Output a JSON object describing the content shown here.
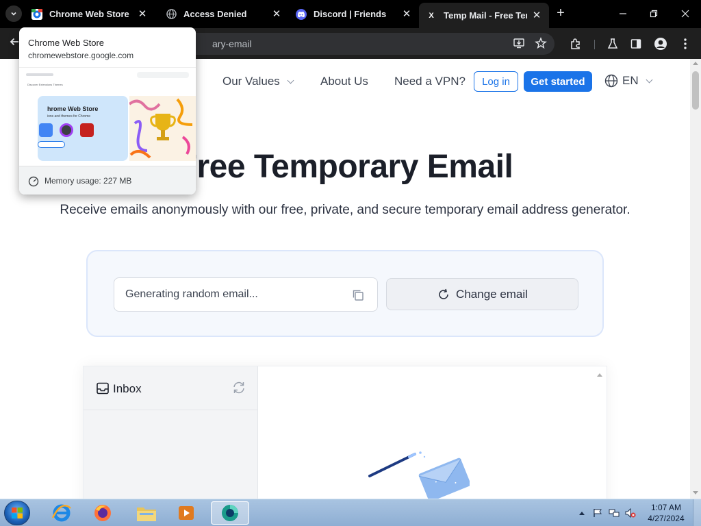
{
  "browser": {
    "tabs": [
      {
        "title": "Chrome Web Store",
        "favicon": "chrome-web-store-icon",
        "active": false
      },
      {
        "title": "Access Denied",
        "favicon": "globe-icon",
        "active": false
      },
      {
        "title": "Discord | Friends",
        "favicon": "discord-icon",
        "active": false
      },
      {
        "title": "Temp Mail - Free Temp",
        "favicon": "x-logo-icon",
        "active": true
      }
    ],
    "new_tab": "+",
    "address": "ary-email"
  },
  "hover_card": {
    "title": "Chrome Web Store",
    "domain": "chromewebstore.google.com",
    "memory": "Memory usage: 227 MB",
    "preview": {
      "banner_title": "hrome Web Store",
      "banner_sub": "ions and themes for Chrome",
      "tabs_text": "Discover   Extensions   Themes"
    }
  },
  "site": {
    "nav": {
      "values": "Our Values",
      "about": "About Us",
      "vpn": "Need a VPN?",
      "login": "Log in",
      "get_started": "Get started",
      "lang": "EN"
    },
    "hero": {
      "title": "Free Temporary Email",
      "subtitle": "Receive emails anonymously with our free, private, and secure temporary email address generator."
    },
    "generator": {
      "email_value": "Generating random email...",
      "change_label": "Change email"
    },
    "inbox": {
      "label": "Inbox"
    }
  },
  "taskbar": {
    "apps": [
      "internet-explorer",
      "firefox",
      "file-explorer",
      "media-player",
      "chrome-web-store"
    ],
    "time": "1:07 AM",
    "date": "4/27/2024"
  },
  "colors": {
    "accent": "#1a73e8",
    "title_text": "#1b1f29",
    "card_bg": "#f5f8fd"
  }
}
